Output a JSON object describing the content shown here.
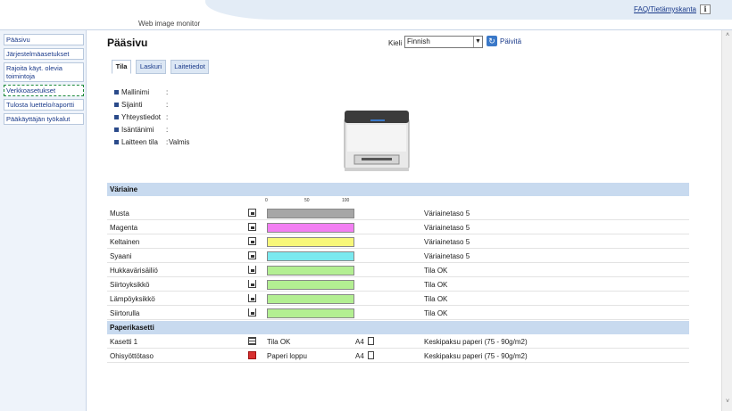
{
  "header": {
    "brand": "Web image monitor",
    "faq_link": "FAQ/Tietämyskanta",
    "info_icon": "i"
  },
  "nav": {
    "items": [
      {
        "label": "Pääsivu"
      },
      {
        "label": "Järjestelmäasetukset"
      },
      {
        "label": "Rajoita käyt. olevia toimintoja"
      },
      {
        "label": "Verkkoasetukset"
      },
      {
        "label": "Tulosta luettelo/raportti"
      },
      {
        "label": "Pääkäyttäjän työkalut"
      }
    ],
    "active_index": 3
  },
  "main": {
    "title": "Pääsivu",
    "language_label": "Kieli",
    "language_value": "Finnish",
    "refresh_label": "Päivitä",
    "tabs": [
      {
        "label": "Tila",
        "active": true
      },
      {
        "label": "Laskuri",
        "active": false
      },
      {
        "label": "Laitetiedot",
        "active": false
      }
    ],
    "info": [
      {
        "label": "Mallinimi",
        "value": ""
      },
      {
        "label": "Sijainti",
        "value": ""
      },
      {
        "label": "Yhteystiedot",
        "value": ""
      },
      {
        "label": "Isäntänimi",
        "value": ""
      },
      {
        "label": "Laitteen tila",
        "value": "Valmis"
      }
    ]
  },
  "supplies": {
    "heading": "Väriaine",
    "scale": [
      "0",
      "50",
      "100"
    ],
    "rows": [
      {
        "name": "Musta",
        "status": "Väriainetaso 5",
        "level": 1.0,
        "color": "#a6a6a6",
        "icon": "toner-icon"
      },
      {
        "name": "Magenta",
        "status": "Väriainetaso 5",
        "level": 1.0,
        "color": "#f27ef2",
        "icon": "toner-icon"
      },
      {
        "name": "Keltainen",
        "status": "Väriainetaso 5",
        "level": 1.0,
        "color": "#f7f77a",
        "icon": "toner-icon"
      },
      {
        "name": "Syaani",
        "status": "Väriainetaso 5",
        "level": 1.0,
        "color": "#7ae9ef",
        "icon": "toner-icon"
      },
      {
        "name": "Hukkavärisäiliö",
        "status": "Tila OK",
        "level": 1.0,
        "color": "#b3ef92",
        "icon": "waste-toner-icon"
      },
      {
        "name": "Siirtoyksikkö",
        "status": "Tila OK",
        "level": 1.0,
        "color": "#b3ef92",
        "icon": "unit-icon"
      },
      {
        "name": "Lämpöyksikkö",
        "status": "Tila OK",
        "level": 1.0,
        "color": "#b3ef92",
        "icon": "unit-icon"
      },
      {
        "name": "Siirtorulla",
        "status": "Tila OK",
        "level": 1.0,
        "color": "#b3ef92",
        "icon": "unit-icon"
      }
    ]
  },
  "trays": {
    "heading": "Paperikasetti",
    "rows": [
      {
        "name": "Kasetti 1",
        "status": "Tila OK",
        "size": "A4",
        "paper": "Keskipaksu paperi (75 - 90g/m2)",
        "error": false
      },
      {
        "name": "Ohisyöttötaso",
        "status": "Paperi loppu",
        "size": "A4",
        "paper": "Keskipaksu paperi (75 - 90g/m2)",
        "error": true
      }
    ]
  }
}
